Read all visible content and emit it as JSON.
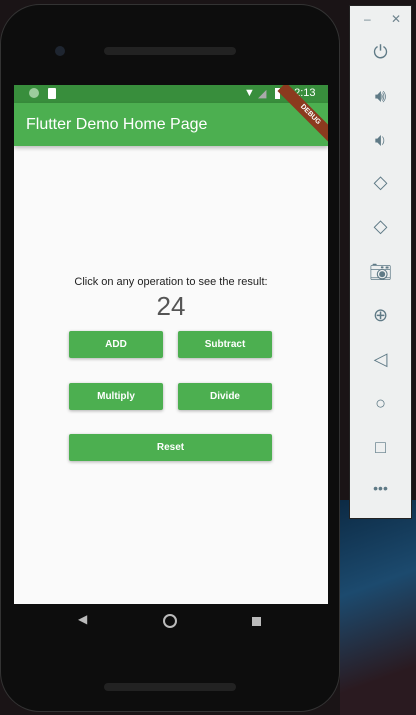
{
  "status_bar": {
    "time": "12:13"
  },
  "app_bar": {
    "title": "Flutter Demo Home Page",
    "debug_banner": "DEBUG"
  },
  "main": {
    "message": "Click on any operation to see the result:",
    "result": "24",
    "buttons": {
      "add": "ADD",
      "subtract": "Subtract",
      "multiply": "Multiply",
      "divide": "Divide",
      "reset": "Reset"
    }
  },
  "colors": {
    "primary": "#4CAF50",
    "primary_dark": "#388E3C"
  },
  "emulator_panel": {
    "icons": [
      "power-icon",
      "volume-up-icon",
      "volume-down-icon",
      "rotate-left-icon",
      "rotate-right-icon",
      "camera-icon",
      "zoom-icon",
      "back-icon",
      "home-icon",
      "overview-icon",
      "more-icon"
    ]
  }
}
